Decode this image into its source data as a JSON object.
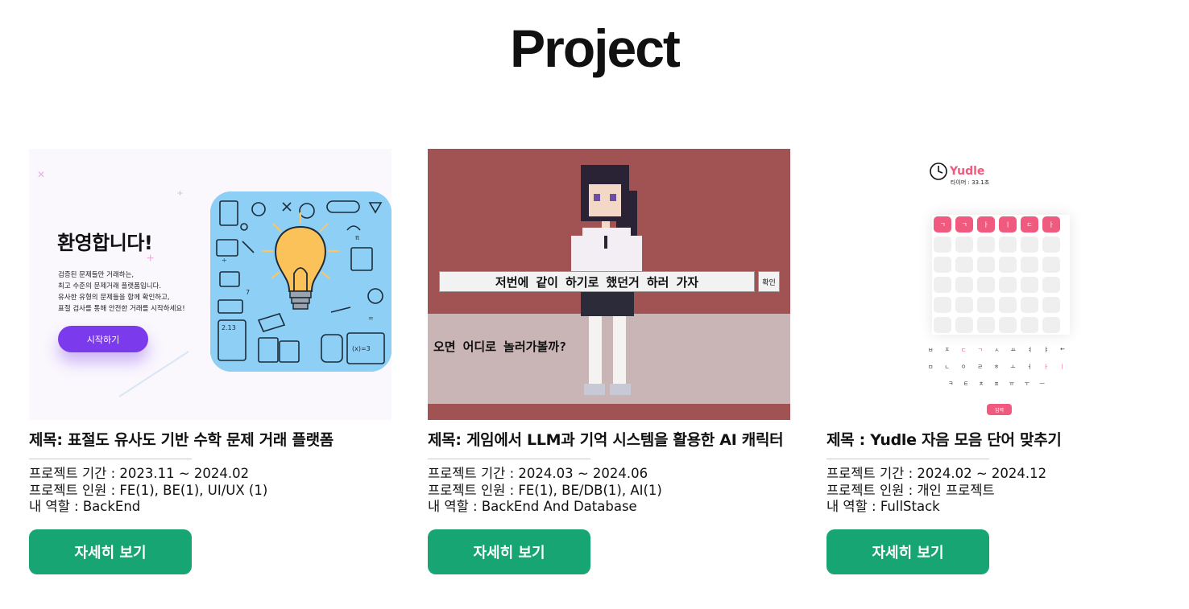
{
  "page": {
    "title": "Project"
  },
  "colors": {
    "button": "#17a673",
    "card3_accent": "#f05a7e",
    "card1_accent": "#7c3aed"
  },
  "projects": [
    {
      "title": "제목: 표절도 유사도 기반 수학 문제 거래 플랫폼",
      "period": "프로젝트 기간 : 2023.11 ~ 2024.02",
      "members": "프로젝트 인원 : FE(1), BE(1), UI/UX (1)",
      "role": "내 역할 : BackEnd",
      "button": "자세히 보기",
      "thumbnail": {
        "heading": "환영합니다!",
        "lines": [
          "검증된 문제들만 거래하는,",
          "최고 수준의 문제거래 플랫폼입니다.",
          "유사한 유형의 문제들을 함께 확인하고,",
          "표절 검사를 통해 안전한 거래를 시작하세요!"
        ],
        "cta": "시작하기",
        "icon": "lightbulb-math-collage"
      }
    },
    {
      "title": "제목: 게임에서 LLM과 기억 시스템을 활용한 AI 캐릭터",
      "period": "프로젝트 기간 : 2024.03 ~ 2024.06",
      "members": "프로젝트 인원 : FE(1), BE/DB(1), AI(1)",
      "role": "내 역할 : BackEnd And Database",
      "button": "자세히 보기",
      "thumbnail": {
        "input_text": "저번에 같이 하기로 했던거 하러 가자",
        "confirm": "확인",
        "npc_line": "오면 어디로 놀러가볼까?",
        "icon": "pixel-character"
      }
    },
    {
      "title": "제목 : Yudle 자음 모음 단어 맞추기",
      "period": "프로젝트 기간 : 2024.02 ~ 2024.12",
      "members": "프로젝트 인원 : 개인 프로젝트",
      "role": "내 역할 : FullStack",
      "button": "자세히 보기",
      "thumbnail": {
        "logo": "Yudle",
        "timer": "타이머 : 33.1초",
        "top_tiles": [
          "ㄱ",
          "ㄱ",
          "ㅏ",
          "ㅣ",
          "ㄷ",
          "ㅏ"
        ],
        "keyboard": [
          [
            "ㅂ",
            "ㅈ",
            "ㄷ",
            "ㄱ",
            "ㅅ",
            "ㅛ",
            "ㅕ",
            "ㅑ",
            "←"
          ],
          [
            "ㅁ",
            "ㄴ",
            "ㅇ",
            "ㄹ",
            "ㅎ",
            "ㅗ",
            "ㅓ",
            "ㅏ",
            "ㅣ"
          ],
          [
            "ㅋ",
            "ㅌ",
            "ㅊ",
            "ㅍ",
            "ㅠ",
            "ㅜ",
            "ㅡ"
          ]
        ],
        "submit": "입력",
        "icon": "clock-icon"
      }
    }
  ]
}
